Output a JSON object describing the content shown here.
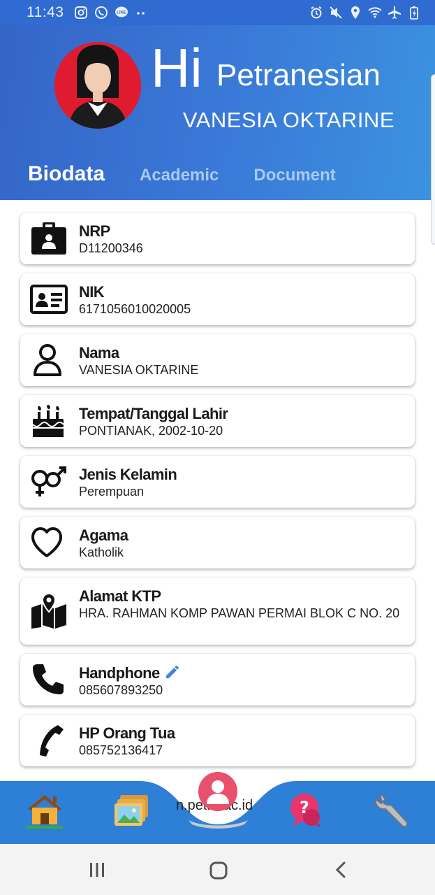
{
  "status_bar": {
    "time": "11:43",
    "left_icons": [
      "instagram-icon",
      "whatsapp-icon",
      "line-icon",
      "more-dots-icon"
    ],
    "right_icons": [
      "alarm-icon",
      "mute-icon",
      "location-icon",
      "wifi-icon",
      "airplane-icon",
      "battery-icon"
    ]
  },
  "header": {
    "greeting": "Hi",
    "nickname": "Petranesian",
    "full_name": "VANESIA OKTARINE",
    "tabs": [
      {
        "label": "Biodata",
        "active": true
      },
      {
        "label": "Academic",
        "active": false
      },
      {
        "label": "Document",
        "active": false
      }
    ]
  },
  "biodata": [
    {
      "icon": "id-badge-icon",
      "label": "NRP",
      "value": "D11200346"
    },
    {
      "icon": "id-card-icon",
      "label": "NIK",
      "value": "6171056010020005"
    },
    {
      "icon": "person-icon",
      "label": "Nama",
      "value": "VANESIA OKTARINE"
    },
    {
      "icon": "birthday-cake-icon",
      "label": "Tempat/Tanggal Lahir",
      "value": "PONTIANAK, 2002-10-20"
    },
    {
      "icon": "gender-icon",
      "label": "Jenis Kelamin",
      "value": "Perempuan"
    },
    {
      "icon": "heart-icon",
      "label": "Agama",
      "value": "Katholik"
    },
    {
      "icon": "map-pin-icon",
      "label": "Alamat KTP",
      "value": "HRA. RAHMAN KOMP PAWAN PERMAI BLOK C NO. 20"
    },
    {
      "icon": "phone-icon",
      "label": "Handphone",
      "value": "085607893250",
      "editable": true
    },
    {
      "icon": "phone-icon",
      "label": "HP Orang Tua",
      "value": "085752136417"
    }
  ],
  "bottom_nav": {
    "items": [
      "home-icon",
      "gallery-icon",
      "profile-icon",
      "help-icon",
      "settings-wrench-icon"
    ],
    "center_text": "n.petra.ac.id"
  },
  "colors": {
    "header_start": "#3465c7",
    "header_end": "#3b93e0",
    "nav_bar": "#2e7fd6",
    "tab_inactive": "#a9c9f2"
  }
}
